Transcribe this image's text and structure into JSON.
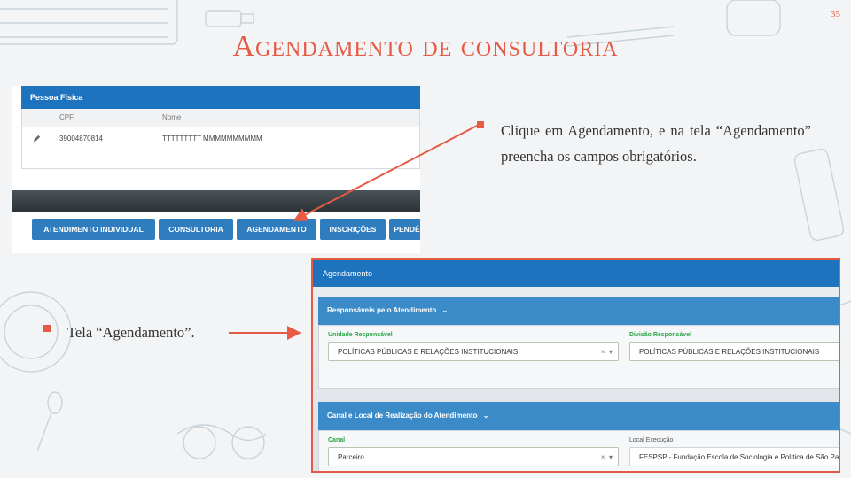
{
  "slide": {
    "title": "Agendamento de consultoria",
    "page_number": "35"
  },
  "screenshot_top": {
    "panel_title": "Pessoa Física",
    "columns": [
      "CPF",
      "Nome"
    ],
    "row": {
      "cpf": "39004870814",
      "nome": "TTTTTTTTT MMMMMMMMMM"
    },
    "buttons": [
      "ATENDIMENTO INDIVIDUAL",
      "CONSULTORIA",
      "AGENDAMENTO",
      "INSCRIÇÕES",
      "PENDÊ"
    ]
  },
  "callouts": {
    "text1": "Clique em Agendamento, e na tela “Agendamento” preencha os campos obrigatórios.",
    "text2": "Tela “Agendamento”."
  },
  "screenshot_bottom": {
    "window_title": "Agendamento",
    "section1": {
      "title": "Responsáveis pelo Atendimento",
      "unidade_label": "Unidade Responsável",
      "unidade_value": "POLÍTICAS PÚBLICAS E RELAÇÕES INSTITUCIONAIS",
      "divisao_label": "Divisão Responsável",
      "divisao_value": "POLÍTICAS PÚBLICAS E RELAÇÕES INSTITUCIONAIS"
    },
    "section2": {
      "title": "Canal e Local de Realização do Atendimento",
      "canal_label": "Canal",
      "canal_value": "Parceiro",
      "local_label": "Local Execução",
      "local_value": "FESPSP - Fundação Escola de Sociologia e Política de São Paulo"
    }
  },
  "colors": {
    "accent": "#e55b45",
    "primary": "#1e73be",
    "button": "#2f7dbf"
  },
  "icons": {
    "edit": "pencil-icon",
    "collapse": "chevron-down-icon",
    "clear": "x-icon",
    "dropdown": "caret-down-icon"
  }
}
